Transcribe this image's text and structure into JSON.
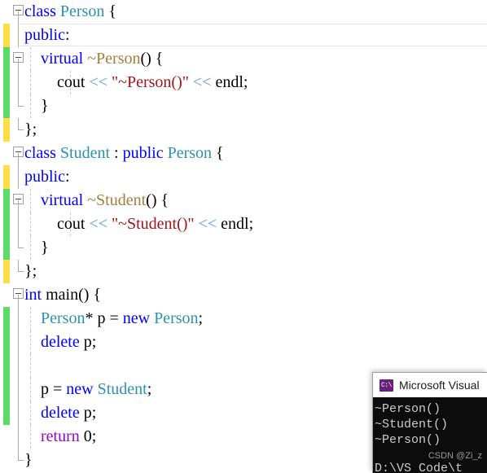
{
  "editor": {
    "language": "cpp",
    "lines": [
      {
        "n": 1,
        "indent": 0,
        "change": "none",
        "fold": "start",
        "current": false,
        "tokens": [
          {
            "t": "class",
            "c": "kw"
          },
          {
            "t": " ",
            "c": "pl"
          },
          {
            "t": "Person",
            "c": "typ"
          },
          {
            "t": " {",
            "c": "pl"
          }
        ],
        "plain": "class Person {"
      },
      {
        "n": 2,
        "indent": 0,
        "change": "unsaved",
        "fold": "line",
        "current": true,
        "tokens": [
          {
            "t": "public",
            "c": "kw"
          },
          {
            "t": ":",
            "c": "pl"
          }
        ],
        "plain": "public:"
      },
      {
        "n": 3,
        "indent": 1,
        "change": "saved",
        "fold": "start",
        "current": false,
        "tokens": [
          {
            "t": "    ",
            "c": "pl"
          },
          {
            "t": "virtual",
            "c": "kw"
          },
          {
            "t": " ",
            "c": "pl"
          },
          {
            "t": "~Person",
            "c": "dtor"
          },
          {
            "t": "() {",
            "c": "pl"
          }
        ],
        "plain": "    virtual ~Person() {"
      },
      {
        "n": 4,
        "indent": 2,
        "change": "saved",
        "fold": "line",
        "current": false,
        "tokens": [
          {
            "t": "        ",
            "c": "pl"
          },
          {
            "t": "cout",
            "c": "pl"
          },
          {
            "t": " ",
            "c": "pl"
          },
          {
            "t": "<<",
            "c": "op"
          },
          {
            "t": " ",
            "c": "pl"
          },
          {
            "t": "\"~Person()\"",
            "c": "str"
          },
          {
            "t": " ",
            "c": "pl"
          },
          {
            "t": "<<",
            "c": "op"
          },
          {
            "t": " ",
            "c": "pl"
          },
          {
            "t": "endl",
            "c": "pl"
          },
          {
            "t": ";",
            "c": "pl"
          }
        ],
        "plain": "        cout << \"~Person()\" << endl;"
      },
      {
        "n": 5,
        "indent": 1,
        "change": "saved",
        "fold": "end",
        "current": false,
        "tokens": [
          {
            "t": "    }",
            "c": "pl"
          }
        ],
        "plain": "    }"
      },
      {
        "n": 6,
        "indent": 0,
        "change": "unsaved",
        "fold": "end",
        "current": false,
        "tokens": [
          {
            "t": "};",
            "c": "pl"
          }
        ],
        "plain": "};"
      },
      {
        "n": 7,
        "indent": 0,
        "change": "none",
        "fold": "start",
        "current": false,
        "tokens": [
          {
            "t": "class",
            "c": "kw"
          },
          {
            "t": " ",
            "c": "pl"
          },
          {
            "t": "Student",
            "c": "typ"
          },
          {
            "t": " : ",
            "c": "pl"
          },
          {
            "t": "public",
            "c": "kw"
          },
          {
            "t": " ",
            "c": "pl"
          },
          {
            "t": "Person",
            "c": "typ"
          },
          {
            "t": " {",
            "c": "pl"
          }
        ],
        "plain": "class Student : public Person {"
      },
      {
        "n": 8,
        "indent": 0,
        "change": "unsaved",
        "fold": "line",
        "current": false,
        "tokens": [
          {
            "t": "public",
            "c": "kw"
          },
          {
            "t": ":",
            "c": "pl"
          }
        ],
        "plain": "public:"
      },
      {
        "n": 9,
        "indent": 1,
        "change": "saved",
        "fold": "start",
        "current": false,
        "tokens": [
          {
            "t": "    ",
            "c": "pl"
          },
          {
            "t": "virtual",
            "c": "kw"
          },
          {
            "t": " ",
            "c": "pl"
          },
          {
            "t": "~Student",
            "c": "dtor"
          },
          {
            "t": "() {",
            "c": "pl"
          }
        ],
        "plain": "    virtual ~Student() {"
      },
      {
        "n": 10,
        "indent": 2,
        "change": "saved",
        "fold": "line",
        "current": false,
        "tokens": [
          {
            "t": "        ",
            "c": "pl"
          },
          {
            "t": "cout",
            "c": "pl"
          },
          {
            "t": " ",
            "c": "pl"
          },
          {
            "t": "<<",
            "c": "op"
          },
          {
            "t": " ",
            "c": "pl"
          },
          {
            "t": "\"~Student()\"",
            "c": "str"
          },
          {
            "t": " ",
            "c": "pl"
          },
          {
            "t": "<<",
            "c": "op"
          },
          {
            "t": " ",
            "c": "pl"
          },
          {
            "t": "endl",
            "c": "pl"
          },
          {
            "t": ";",
            "c": "pl"
          }
        ],
        "plain": "        cout << \"~Student()\" << endl;"
      },
      {
        "n": 11,
        "indent": 1,
        "change": "saved",
        "fold": "end",
        "current": false,
        "tokens": [
          {
            "t": "    }",
            "c": "pl"
          }
        ],
        "plain": "    }"
      },
      {
        "n": 12,
        "indent": 0,
        "change": "unsaved",
        "fold": "end",
        "current": false,
        "tokens": [
          {
            "t": "};",
            "c": "pl"
          }
        ],
        "plain": "};"
      },
      {
        "n": 13,
        "indent": 0,
        "change": "none",
        "fold": "start",
        "current": false,
        "tokens": [
          {
            "t": "int",
            "c": "kw"
          },
          {
            "t": " ",
            "c": "pl"
          },
          {
            "t": "main",
            "c": "pl"
          },
          {
            "t": "() {",
            "c": "pl"
          }
        ],
        "plain": "int main() {"
      },
      {
        "n": 14,
        "indent": 1,
        "change": "saved",
        "fold": "line",
        "current": false,
        "tokens": [
          {
            "t": "    ",
            "c": "pl"
          },
          {
            "t": "Person",
            "c": "typ"
          },
          {
            "t": "* p = ",
            "c": "pl"
          },
          {
            "t": "new",
            "c": "kw"
          },
          {
            "t": " ",
            "c": "pl"
          },
          {
            "t": "Person",
            "c": "typ"
          },
          {
            "t": ";",
            "c": "pl"
          }
        ],
        "plain": "    Person* p = new Person;"
      },
      {
        "n": 15,
        "indent": 1,
        "change": "saved",
        "fold": "line",
        "current": false,
        "tokens": [
          {
            "t": "    ",
            "c": "pl"
          },
          {
            "t": "delete",
            "c": "kw"
          },
          {
            "t": " p;",
            "c": "pl"
          }
        ],
        "plain": "    delete p;"
      },
      {
        "n": 16,
        "indent": 1,
        "change": "saved",
        "fold": "line",
        "current": false,
        "tokens": [],
        "plain": ""
      },
      {
        "n": 17,
        "indent": 1,
        "change": "saved",
        "fold": "line",
        "current": false,
        "tokens": [
          {
            "t": "    p = ",
            "c": "pl"
          },
          {
            "t": "new",
            "c": "kw"
          },
          {
            "t": " ",
            "c": "pl"
          },
          {
            "t": "Student",
            "c": "typ"
          },
          {
            "t": ";",
            "c": "pl"
          }
        ],
        "plain": "    p = new Student;"
      },
      {
        "n": 18,
        "indent": 1,
        "change": "saved",
        "fold": "line",
        "current": false,
        "tokens": [
          {
            "t": "    ",
            "c": "pl"
          },
          {
            "t": "delete",
            "c": "kw"
          },
          {
            "t": " p;",
            "c": "pl"
          }
        ],
        "plain": "    delete p;"
      },
      {
        "n": 19,
        "indent": 1,
        "change": "none",
        "fold": "line",
        "current": false,
        "tokens": [
          {
            "t": "    ",
            "c": "pl"
          },
          {
            "t": "return",
            "c": "ctl"
          },
          {
            "t": " 0;",
            "c": "pl"
          }
        ],
        "plain": "    return 0;"
      },
      {
        "n": 20,
        "indent": 0,
        "change": "none",
        "fold": "end",
        "current": false,
        "tokens": [
          {
            "t": "}",
            "c": "pl"
          }
        ],
        "plain": "}"
      }
    ]
  },
  "console": {
    "title": "Microsoft Visual",
    "icon": "console-app-icon",
    "output_lines": [
      "~Person()",
      "~Student()",
      "~Person()"
    ],
    "watermark": "CSDN @Zi_z",
    "path_line": "D:\\VS Code\\t"
  },
  "colors": {
    "keyword": "#0000ff",
    "control": "#8f08c4",
    "type": "#2b91af",
    "destructor": "#a0803c",
    "string": "#a31515",
    "operator": "#5b9bd5",
    "plain": "#000000",
    "change_saved": "#5ddb67",
    "change_unsaved": "#ffdd45",
    "console_bg": "#0c0c0c",
    "console_fg": "#cccccc"
  }
}
